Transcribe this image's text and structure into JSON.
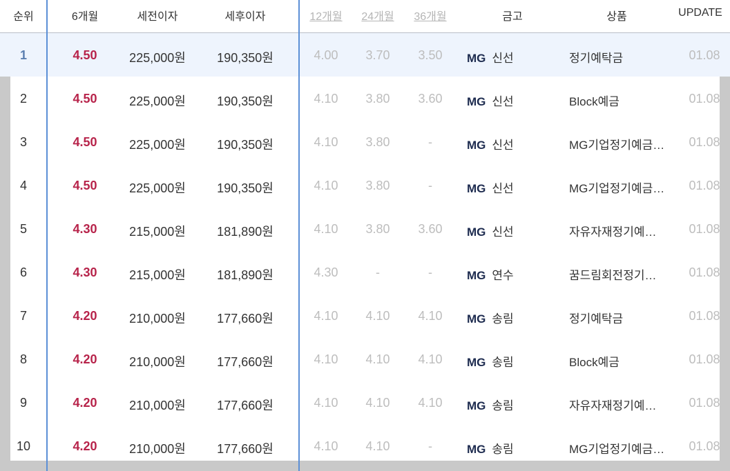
{
  "headers": {
    "rank": "순위",
    "m6": "6개월",
    "pre_tax": "세전이자",
    "post_tax": "세후이자",
    "m12": "12개월",
    "m24": "24개월",
    "m36": "36개월",
    "bank": "금고",
    "product": "상품",
    "update": "UPDATE"
  },
  "rows": [
    {
      "rank": "1",
      "m6": "4.50",
      "pre": "225,000원",
      "post": "190,350원",
      "m12": "4.00",
      "m24": "3.70",
      "m36": "3.50",
      "mg": "MG",
      "bank": "신선",
      "product": "정기예탁금",
      "update": "01.08"
    },
    {
      "rank": "2",
      "m6": "4.50",
      "pre": "225,000원",
      "post": "190,350원",
      "m12": "4.10",
      "m24": "3.80",
      "m36": "3.60",
      "mg": "MG",
      "bank": "신선",
      "product": "Block예금",
      "update": "01.08"
    },
    {
      "rank": "3",
      "m6": "4.50",
      "pre": "225,000원",
      "post": "190,350원",
      "m12": "4.10",
      "m24": "3.80",
      "m36": "-",
      "mg": "MG",
      "bank": "신선",
      "product": "MG기업정기예금…",
      "update": "01.08"
    },
    {
      "rank": "4",
      "m6": "4.50",
      "pre": "225,000원",
      "post": "190,350원",
      "m12": "4.10",
      "m24": "3.80",
      "m36": "-",
      "mg": "MG",
      "bank": "신선",
      "product": "MG기업정기예금…",
      "update": "01.08"
    },
    {
      "rank": "5",
      "m6": "4.30",
      "pre": "215,000원",
      "post": "181,890원",
      "m12": "4.10",
      "m24": "3.80",
      "m36": "3.60",
      "mg": "MG",
      "bank": "신선",
      "product": "자유자재정기예…",
      "update": "01.08"
    },
    {
      "rank": "6",
      "m6": "4.30",
      "pre": "215,000원",
      "post": "181,890원",
      "m12": "4.30",
      "m24": "-",
      "m36": "-",
      "mg": "MG",
      "bank": "연수",
      "product": "꿈드림회전정기…",
      "update": "01.08"
    },
    {
      "rank": "7",
      "m6": "4.20",
      "pre": "210,000원",
      "post": "177,660원",
      "m12": "4.10",
      "m24": "4.10",
      "m36": "4.10",
      "mg": "MG",
      "bank": "송림",
      "product": "정기예탁금",
      "update": "01.08"
    },
    {
      "rank": "8",
      "m6": "4.20",
      "pre": "210,000원",
      "post": "177,660원",
      "m12": "4.10",
      "m24": "4.10",
      "m36": "4.10",
      "mg": "MG",
      "bank": "송림",
      "product": "Block예금",
      "update": "01.08"
    },
    {
      "rank": "9",
      "m6": "4.20",
      "pre": "210,000원",
      "post": "177,660원",
      "m12": "4.10",
      "m24": "4.10",
      "m36": "4.10",
      "mg": "MG",
      "bank": "송림",
      "product": "자유자재정기예…",
      "update": "01.08"
    },
    {
      "rank": "10",
      "m6": "4.20",
      "pre": "210,000원",
      "post": "177,660원",
      "m12": "4.10",
      "m24": "4.10",
      "m36": "-",
      "mg": "MG",
      "bank": "송림",
      "product": "MG기업정기예금…",
      "update": "01.08"
    }
  ],
  "colors": {
    "rate_highlight": "#b7234a",
    "muted": "#bdbdbd",
    "column_divider": "#5b8fd6",
    "row_highlight": "#eef4fd"
  }
}
